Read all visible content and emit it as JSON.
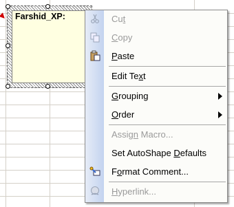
{
  "comment": {
    "title": "Farshid_XP:"
  },
  "menu": {
    "items": [
      {
        "pre": "Cu",
        "acc": "t",
        "post": "",
        "disabled": true,
        "icon": "scissors-icon"
      },
      {
        "pre": "",
        "acc": "C",
        "post": "opy",
        "disabled": true,
        "icon": "copy-icon"
      },
      {
        "pre": "",
        "acc": "P",
        "post": "aste",
        "disabled": false,
        "icon": "paste-icon"
      },
      {
        "pre": "Edit Te",
        "acc": "x",
        "post": "t",
        "disabled": false
      },
      {
        "pre": "",
        "acc": "G",
        "post": "rouping",
        "disabled": false,
        "submenu": true
      },
      {
        "pre": "",
        "acc": "O",
        "post": "rder",
        "disabled": false,
        "submenu": true
      },
      {
        "pre": "Assig",
        "acc": "n",
        "post": " Macro...",
        "disabled": true
      },
      {
        "pre": "Set AutoShape ",
        "acc": "D",
        "post": "efaults",
        "disabled": false
      },
      {
        "pre": "F",
        "acc": "o",
        "post": "rmat Comment...",
        "disabled": false,
        "icon": "format-comment-icon"
      },
      {
        "pre": "",
        "acc": "H",
        "post": "yperlink...",
        "disabled": true,
        "icon": "hyperlink-icon"
      }
    ]
  }
}
